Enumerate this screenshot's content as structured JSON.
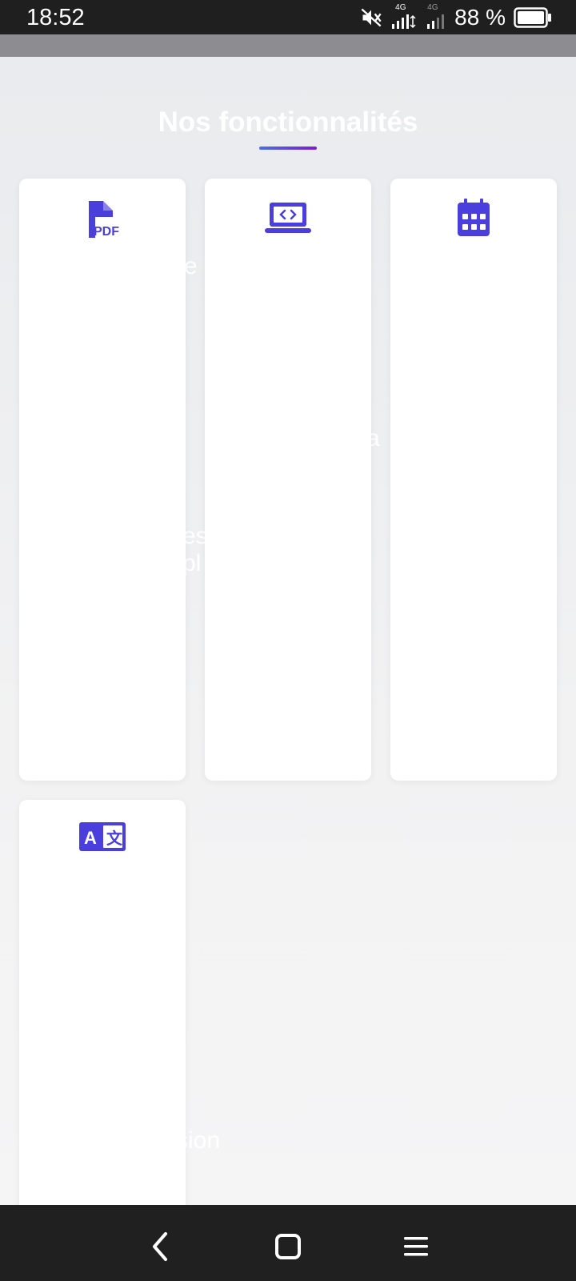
{
  "status_bar": {
    "time": "18:52",
    "network_label_1": "4G",
    "network_label_2": "4G",
    "battery_percent": "88 %"
  },
  "features": {
    "title": "Nos fonctionnalités",
    "ghost_texts": [
      "e",
      "a",
      "es",
      "pl",
      "sion"
    ],
    "cards": [
      {
        "icon": "pdf-file-icon"
      },
      {
        "icon": "laptop-code-icon"
      },
      {
        "icon": "calendar-icon"
      },
      {
        "icon": "translate-icon"
      }
    ]
  },
  "colors": {
    "accent": "#4a3fdc",
    "underline_start": "#4a6ee0",
    "underline_end": "#7b1fd0"
  },
  "nav": {
    "back": "back-icon",
    "home": "home-icon",
    "menu": "menu-icon"
  }
}
